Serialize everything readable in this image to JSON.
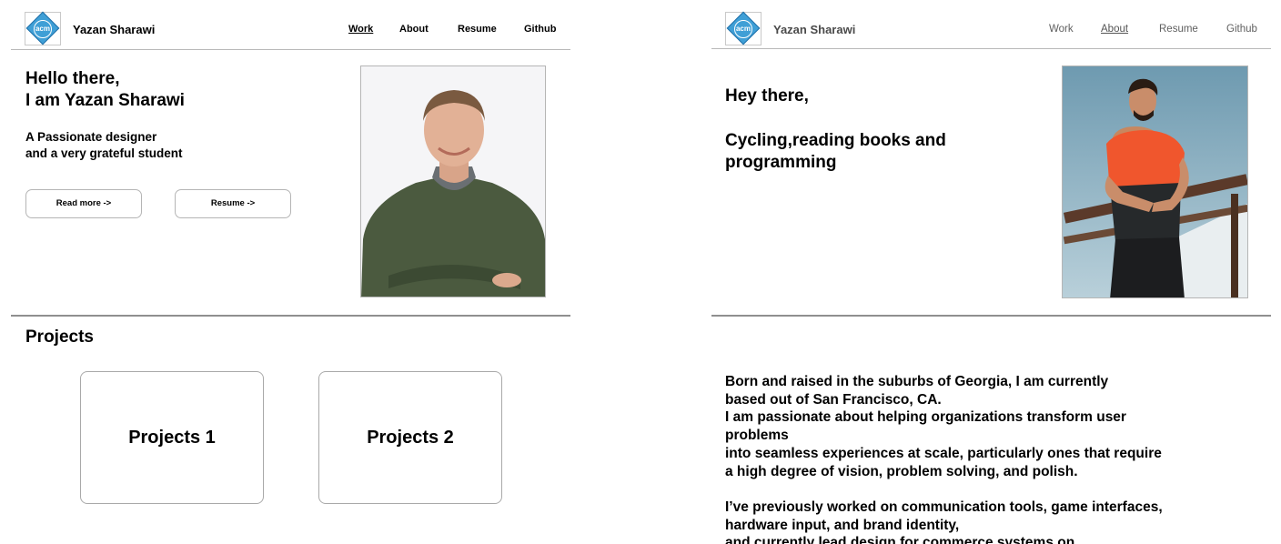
{
  "left_page": {
    "header": {
      "logo_text": "acm",
      "brand": "Yazan Sharawi",
      "nav": [
        {
          "label": "Work",
          "active": true
        },
        {
          "label": "About",
          "active": false
        },
        {
          "label": "Resume",
          "active": false
        },
        {
          "label": "Github",
          "active": false
        }
      ]
    },
    "hero": {
      "greeting_line1": "Hello there,",
      "greeting_line2": "I am Yazan Sharawi",
      "tagline_line1": "A Passionate designer",
      "tagline_line2": "and a very grateful student",
      "read_more_label": "Read more ->",
      "resume_label": "Resume ->"
    },
    "projects": {
      "title": "Projects",
      "cards": [
        {
          "label": "Projects 1"
        },
        {
          "label": "Projects 2"
        }
      ]
    }
  },
  "right_page": {
    "header": {
      "logo_text": "acm",
      "brand": "Yazan Sharawi",
      "nav": [
        {
          "label": "Work",
          "active": false
        },
        {
          "label": "About",
          "active": true
        },
        {
          "label": "Resume",
          "active": false
        },
        {
          "label": "Github",
          "active": false
        }
      ]
    },
    "hero": {
      "greeting": "Hey there,",
      "hobbies_line1": "Cycling,reading books and",
      "hobbies_line2": "programming"
    },
    "bio": {
      "lines": [
        "Born and raised in the suburbs of Georgia, I am currently",
        "based out of San Francisco, CA.",
        "I am passionate about helping organizations transform user",
        "problems",
        "into seamless experiences at scale, particularly ones that require",
        "a high degree of vision, problem solving, and polish."
      ],
      "lines2": [
        "I’ve previously worked on communication tools, game interfaces,",
        "hardware input, and brand identity,",
        "and currently lead design for commerce systems on"
      ]
    }
  },
  "colors": {
    "logo_blue": "#3f9fd6",
    "divider": "#8f8f8f",
    "border": "#b5b5b5",
    "shirt_orange": "#f0562d"
  }
}
